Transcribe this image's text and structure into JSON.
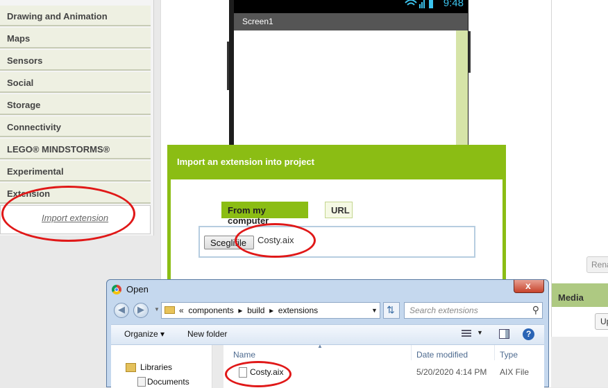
{
  "palette": {
    "categories": [
      "Drawing and Animation",
      "Maps",
      "Sensors",
      "Social",
      "Storage",
      "Connectivity",
      "LEGO® MINDSTORMS®",
      "Experimental",
      "Extension"
    ],
    "import_link": "Import extension"
  },
  "viewer": {
    "clock": "9:48",
    "screen_title": "Screen1"
  },
  "right_panel": {
    "rename_label": "Rena",
    "media_label": "Media",
    "upload_label": "Up"
  },
  "import_dialog": {
    "title": "Import an extension into project",
    "tab_computer": "From my computer",
    "tab_url": "URL",
    "choose_button": "Sceglifile",
    "chosen_file": "Costy.aix"
  },
  "open_dialog": {
    "title": "Open",
    "close_glyph": "x",
    "address_path": "«  components  ▸  build  ▸  extensions",
    "search_placeholder": "Search extensions",
    "organize_label": "Organize ▾",
    "new_folder_label": "New folder",
    "nav": [
      {
        "label": "Libraries"
      },
      {
        "label": "Documents"
      }
    ],
    "columns": {
      "name": "Name",
      "date": "Date modified",
      "type": "Type"
    },
    "files": [
      {
        "name": "Costy.aix",
        "date": "5/20/2020 4:14 PM",
        "type": "AIX File"
      }
    ]
  },
  "annotation_color": "#e01818",
  "accent_green": "#8bbd14"
}
